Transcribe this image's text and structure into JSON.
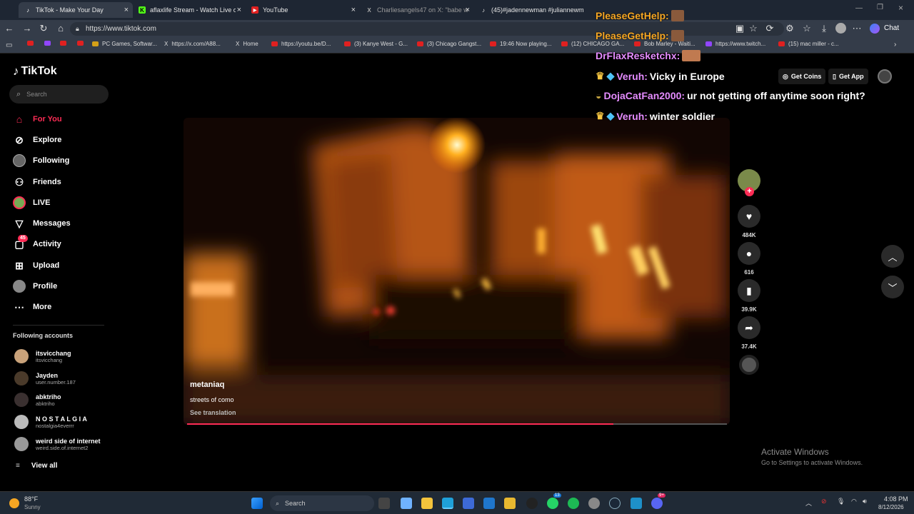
{
  "browser": {
    "tabs": [
      {
        "label": "TikTok - Make Your Day",
        "icon": "tiktok-icon",
        "active": true
      },
      {
        "label": "aflaxlife Stream - Watch Live on Ki",
        "icon": "kick-icon"
      },
      {
        "label": "YouTube",
        "icon": "youtube-icon"
      },
      {
        "label": "Charliesangels47 on X: \"babe wa",
        "icon": "x-icon"
      },
      {
        "label": "(45)#jadennewman #juliannewma",
        "icon": "tiktok-icon"
      }
    ],
    "url": "https://www.tiktok.com",
    "chat_label": "Chat",
    "bookmarks": [
      {
        "label": "",
        "icon": "youtube-icon"
      },
      {
        "label": "",
        "icon": "twitch-icon"
      },
      {
        "label": "",
        "icon": "youtube-icon"
      },
      {
        "label": "",
        "icon": "youtube-icon"
      },
      {
        "label": "PC Games, Softwar...",
        "icon": "game-icon"
      },
      {
        "label": "https://x.com/A88...",
        "icon": "x-icon"
      },
      {
        "label": "Home",
        "icon": "x-icon"
      },
      {
        "label": "https://youtu.be/D...",
        "icon": "youtube-icon"
      },
      {
        "label": "(3) Kanye West - G...",
        "icon": "youtube-icon"
      },
      {
        "label": "(3) Chicago Gangst...",
        "icon": "youtube-icon"
      },
      {
        "label": "19:46 Now playing...",
        "icon": "youtube-icon"
      },
      {
        "label": "(12) CHICAGO GA...",
        "icon": "youtube-icon"
      },
      {
        "label": "Bob Marley - Waiti...",
        "icon": "youtube-icon"
      },
      {
        "label": "https://www.twitch...",
        "icon": "twitch-icon"
      },
      {
        "label": "(15) mac miller - c...",
        "icon": "youtube-icon"
      }
    ]
  },
  "tiktok": {
    "logo": "TikTok",
    "search_placeholder": "Search",
    "nav": [
      {
        "label": "For You",
        "icon": "home-icon",
        "active": true
      },
      {
        "label": "Explore",
        "icon": "compass-icon"
      },
      {
        "label": "Following",
        "icon": "following-avatar-icon"
      },
      {
        "label": "Friends",
        "icon": "friends-icon"
      },
      {
        "label": "LIVE",
        "icon": "live-icon"
      },
      {
        "label": "Messages",
        "icon": "send-icon"
      },
      {
        "label": "Activity",
        "icon": "activity-icon",
        "badge": "45"
      },
      {
        "label": "Upload",
        "icon": "upload-icon"
      },
      {
        "label": "Profile",
        "icon": "profile-avatar-icon"
      },
      {
        "label": "More",
        "icon": "more-icon"
      }
    ],
    "following_title": "Following accounts",
    "following": [
      {
        "name": "itsvicchang",
        "handle": "itsvicchang"
      },
      {
        "name": "Jayden",
        "handle": "user.number.187"
      },
      {
        "name": "abktriho",
        "handle": "abktriho"
      },
      {
        "name": "N O S T A L G I A",
        "handle": "nostalgia4everrr"
      },
      {
        "name": "weird side of internet",
        "handle": "weird.side.of.internet2"
      }
    ],
    "view_all": "View all",
    "top_buttons": {
      "coins": "Get Coins",
      "app": "Get App"
    },
    "video": {
      "author": "metaniaq",
      "caption": "streets of como",
      "translate": "See translation",
      "progress": 0.79
    },
    "actions": {
      "likes": "484K",
      "comments": "616",
      "saves": "39.9K",
      "shares": "37.4K"
    }
  },
  "chat_overlay": [
    {
      "user": "PleaseGetHelp:",
      "text": "",
      "color": "#f5a623"
    },
    {
      "user": "PleaseGetHelp:",
      "text": "",
      "color": "#f5a623"
    },
    {
      "user": "DrFlaxResketchx:",
      "text": "",
      "color": "#e58cff"
    },
    {
      "user": "Veruh:",
      "text": "Vicky in Europe",
      "color": "#e58cff"
    },
    {
      "user": "DojaCatFan2000:",
      "text": "ur not getting off anytime soon right?",
      "color": "#e58cff"
    },
    {
      "user": "Veruh:",
      "text": "winter soldier",
      "color": "#e58cff"
    }
  ],
  "watermark": {
    "title": "Activate Windows",
    "subtitle": "Go to Settings to activate Windows."
  },
  "taskbar": {
    "weather_temp": "88°F",
    "weather_desc": "Sunny",
    "search": "Search",
    "time": "4:08 PM",
    "date": "8/12/2026",
    "badges": {
      "whatsapp": "13",
      "discord": "9+"
    }
  }
}
